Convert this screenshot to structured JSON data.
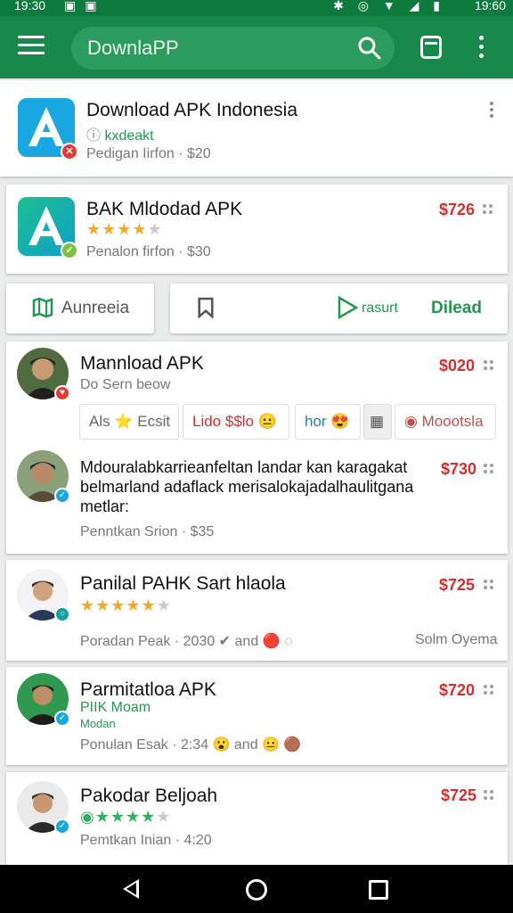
{
  "status": {
    "time_left": "19:30",
    "time_right": "19:60"
  },
  "search": {
    "placeholder": "DownlaPP"
  },
  "colors": {
    "brand": "#17884a",
    "price": "#d32f2f",
    "star": "#f2a823",
    "link_green": "#1e9a4f"
  },
  "featured": [
    {
      "title": "Download APK Indonesia",
      "tag": "kxdeakt",
      "meta": "Pedigan Iirfon  · $20",
      "badge": "x",
      "icon": "app-logo-icon"
    },
    {
      "title": "BAK Mldodad APK",
      "rating_stars": 4,
      "meta": "Penalon firfon  · $30",
      "price": "$726",
      "badge": "check",
      "icon": "app-logo-icon"
    }
  ],
  "tabs": [
    {
      "label": "Aunreeia",
      "icon": "map-icon"
    },
    {
      "label": "Dilead",
      "icon": "bookmark-icon",
      "middle_label": "rasurt",
      "middle_icon": "play-icon"
    }
  ],
  "reviews": [
    {
      "name": "Mannload APK",
      "sub": "Do Sern beow",
      "price": "$020"
    },
    {
      "text": "Mdouralabkarrieanfeltan landar kan karagakat belmarland adaflack merisalokajadalhaulitgana metlar:",
      "meta": "Penntkan Srion  · $35",
      "price": "$730"
    }
  ],
  "chips": [
    {
      "label": "Als ⭐ Ecsit"
    },
    {
      "label": "Lido $$lo 😐"
    },
    {
      "label": "hor 😍"
    },
    {
      "label": "▦"
    },
    {
      "label": "Moootsla"
    }
  ],
  "list": [
    {
      "name": "Panilal PAHK Sart hlaola",
      "stars": 5,
      "meta": "Poradan Peak · 2030 ✔ and 🔴 ◌",
      "right": "Solm Oyema",
      "price": "$725"
    },
    {
      "name": "Parmitatloa APK",
      "tag": "PIIK Moam",
      "tag2": "Modan",
      "meta": "Ponulan Esak  · 2:34 😮 and 😐 🟤",
      "price": "$720"
    },
    {
      "name": "Pakodar Beljoah",
      "stars": 5,
      "meta": "Pemtkan Inian  · 4:20",
      "price": "$725"
    }
  ]
}
